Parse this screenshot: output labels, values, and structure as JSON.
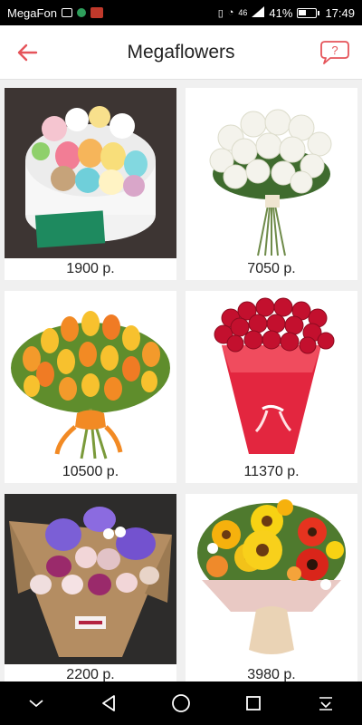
{
  "status_bar": {
    "carrier": "MegaFon",
    "network": "46",
    "battery": "41%",
    "time": "17:49"
  },
  "header": {
    "title": "Megaflowers",
    "back_icon": "back-arrow-icon",
    "help_icon": "help-bubble-icon",
    "accent_color": "#e5545a"
  },
  "products": [
    {
      "price": "1900 р.",
      "image": "macarons-flower-box",
      "badge": "MEGAFLOWERS"
    },
    {
      "price": "7050 р.",
      "image": "white-roses-bouquet"
    },
    {
      "price": "10500 р.",
      "image": "orange-tulips-bouquet"
    },
    {
      "price": "11370 р.",
      "image": "red-roses-bouquet"
    },
    {
      "price": "2200 р.",
      "image": "orchid-roses-bouquet"
    },
    {
      "price": "3980 р.",
      "image": "gerbera-mixed-bouquet"
    }
  ],
  "nav_bar": {
    "icons": [
      "chevron-down-icon",
      "back-triangle-icon",
      "home-circle-icon",
      "recents-square-icon",
      "notifications-pull-icon"
    ]
  }
}
